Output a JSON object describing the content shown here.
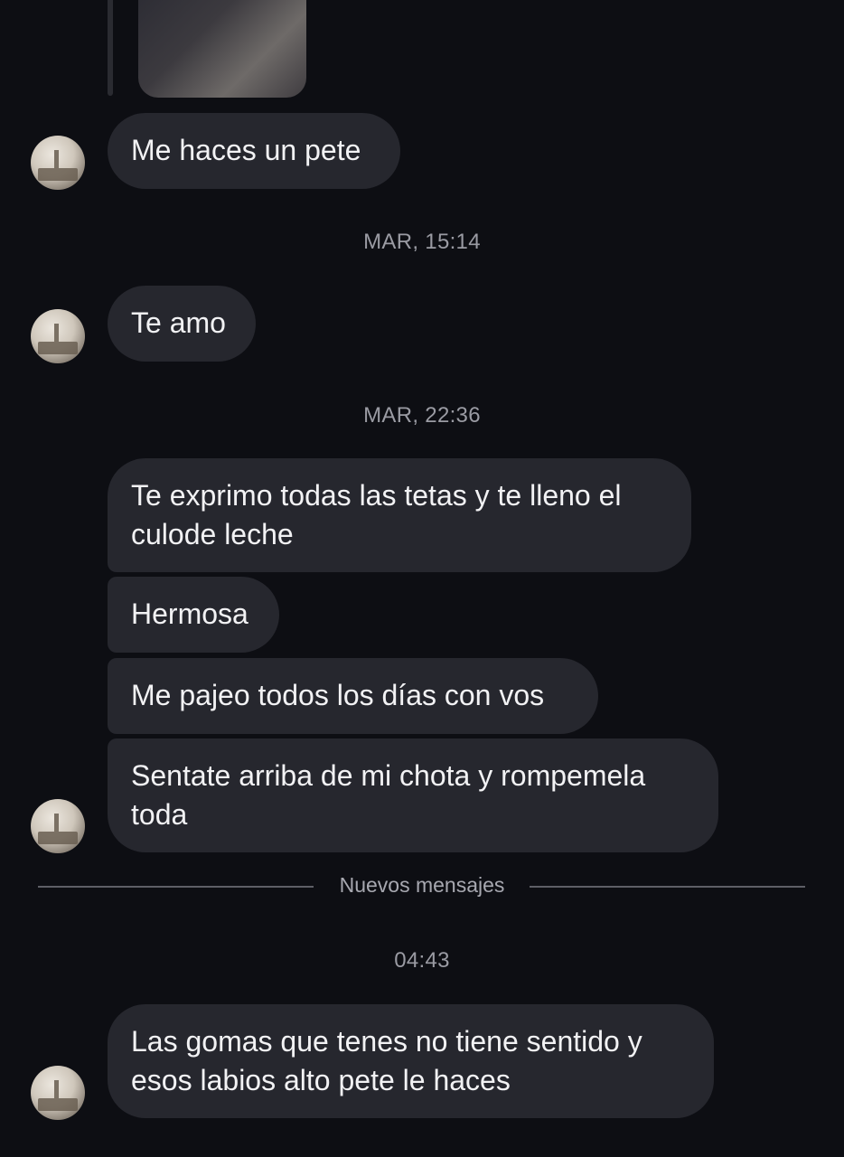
{
  "chat": {
    "messages": [
      {
        "text": "Me haces un pete"
      },
      {
        "text": "Te amo"
      },
      {
        "text": "Te exprimo todas las tetas y te lleno el culode leche"
      },
      {
        "text": "Hermosa"
      },
      {
        "text": "Me pajeo todos los días con vos"
      },
      {
        "text": "Sentate arriba de mi chota y rompemela toda"
      },
      {
        "text": "Las gomas que tenes no tiene sentido y esos labios alto pete le haces"
      }
    ],
    "timestamps": [
      "MAR, 15:14",
      "MAR, 22:36",
      "04:43"
    ],
    "new_messages_divider": "Nuevos mensajes"
  },
  "colors": {
    "background": "#0d0e13",
    "bubble": "#26272e",
    "text": "#f2f2f4",
    "muted": "#9a9ba3"
  }
}
